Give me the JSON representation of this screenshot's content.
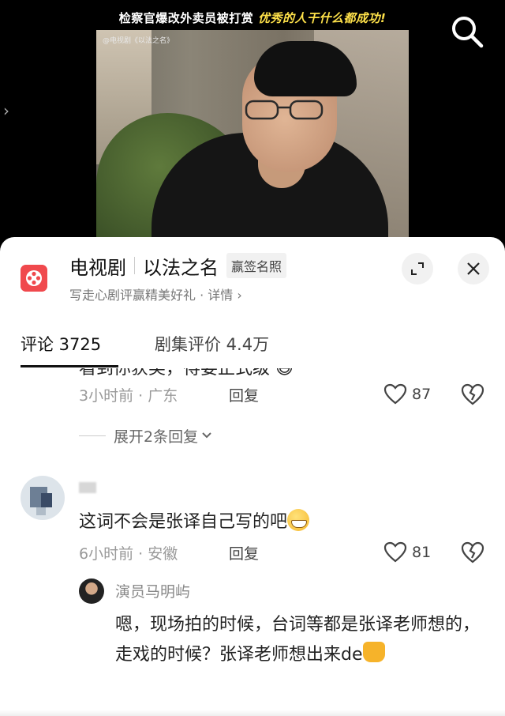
{
  "video": {
    "caption_main": "检察官爆改外卖员被打赏",
    "caption_highlight": "优秀的人干什么都成功!",
    "watermark": "@电视剧《以法之名》",
    "search_icon": "search-icon"
  },
  "show": {
    "type": "电视剧",
    "name": "以法之名",
    "badge": "赢签名照",
    "subtitle": "写走心剧评赢精美好礼 · 详情",
    "icon": "film-reel-icon",
    "accent_color": "#f0494d"
  },
  "tabs": {
    "comments_label": "评论 3725",
    "ratings_label": "剧集评价 4.4万"
  },
  "comments": {
    "first": {
      "cut_text": "看到你获奖，得要正式级 😄",
      "time_location": "3小时前 · 广东",
      "reply_label": "回复",
      "likes": "87",
      "expand_label": "展开2条回复"
    },
    "second": {
      "text": "这词不会是张译自己写的吧",
      "time_location": "6小时前 · 安徽",
      "reply_label": "回复",
      "likes": "81",
      "reply": {
        "username": "演员马明屿",
        "text": "嗯，现场拍的时候，台词等都是张译老师想的，走戏的时候？张译老师想出来de"
      }
    }
  }
}
